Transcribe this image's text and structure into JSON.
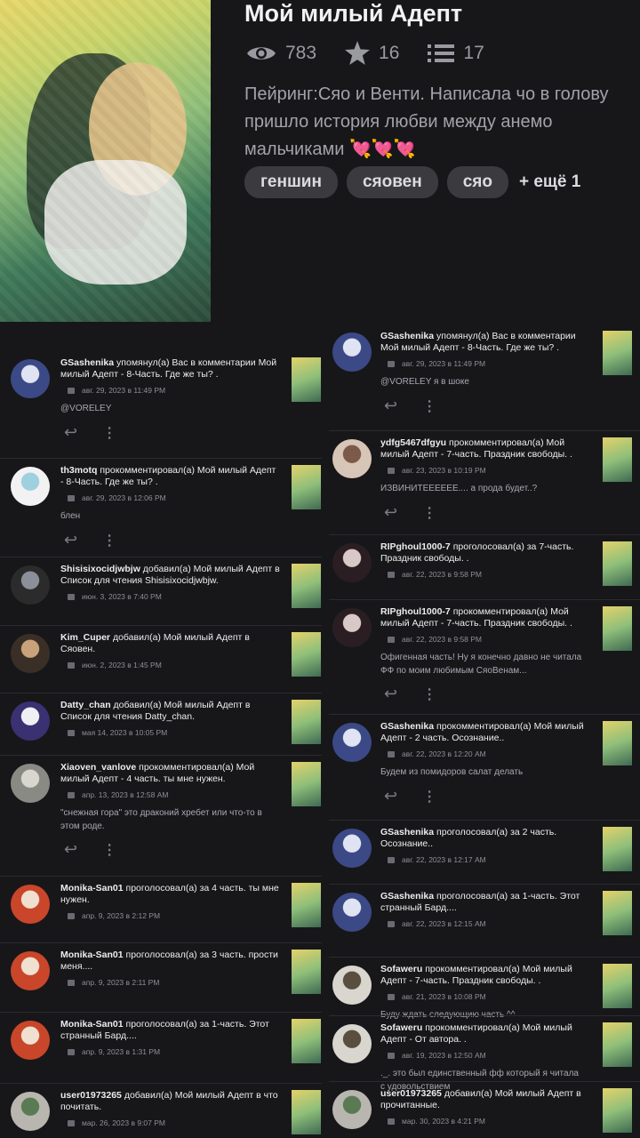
{
  "work": {
    "title": "Мой милый Адепт",
    "views": "783",
    "likes": "16",
    "parts": "17",
    "description": "Пейринг:Сяо и Венти. Написала чо в голову пришло история любви между анемо мальчиками 💘💘💘",
    "tags": [
      "геншин",
      "сяовен",
      "сяо"
    ],
    "more_tags": "+ ещё 1"
  },
  "left": [
    {
      "user": "GSashenika",
      "action": "упомянул(а) Вас в комментарии Мой милый Адепт - 8-Часть. Где же ты? .",
      "time": "авг. 29, 2023 в 11:49 PM",
      "body": "@VORELEY"
    },
    {
      "user": "th3motq",
      "action": "прокомментировал(а) Мой милый Адепт - 8-Часть. Где же ты? .",
      "time": "авг. 29, 2023 в 12:06 PM",
      "body": "блен"
    },
    {
      "user": "Shisisixocidjwbjw",
      "action": "добавил(а) Мой милый Адепт в Список для чтения Shisisixocidjwbjw.",
      "time": "июн. 3, 2023 в 7:40 PM"
    },
    {
      "user": "Kim_Cuper",
      "action": "добавил(а) Мой милый Адепт в Сяовен.",
      "time": "июн. 2, 2023 в 1:45 PM"
    },
    {
      "user": "Datty_chan",
      "action": "добавил(а) Мой милый Адепт в Список для чтения Datty_chan.",
      "time": "мая 14, 2023 в 10:05 PM"
    },
    {
      "user": "Xiaoven_vanlove",
      "action": "прокомментировал(а) Мой милый Адепт - 4 часть. ты мне нужен.",
      "time": "апр. 13, 2023 в 12:58 AM",
      "body": "\"снежная гора\" это драконий хребет или что-то в этом роде."
    },
    {
      "user": "Monika-San01",
      "action": "проголосовал(а) за 4 часть. ты мне нужен.",
      "time": "апр. 9, 2023 в 2:12 PM"
    },
    {
      "user": "Monika-San01",
      "action": "проголосовал(а) за 3 часть. прости меня....",
      "time": "апр. 9, 2023 в 2:11 PM"
    },
    {
      "user": "Monika-San01",
      "action": "проголосовал(а) за 1-часть. Этот странный Бард....",
      "time": "апр. 9, 2023 в 1:31 PM"
    },
    {
      "user": "user01973265",
      "action": "добавил(а) Мой милый Адепт в что почитать.",
      "time": "мар. 26, 2023 в 9:07 PM"
    }
  ],
  "right": [
    {
      "user": "GSashenika",
      "action": "упомянул(а) Вас в комментарии Мой милый Адепт - 8-Часть. Где же ты? .",
      "time": "авг. 29, 2023 в 11:49 PM",
      "body": "@VORELEY я в шоке"
    },
    {
      "user": "ydfg5467dfgyu",
      "action": "прокомментировал(а) Мой милый Адепт - 7-часть. Праздник свободы. .",
      "time": "авг. 23, 2023 в 10:19 PM",
      "body": "ИЗВИНИТЕЕЕЕЕЕ.... а прода будет..?"
    },
    {
      "user": "RIPghoul1000-7",
      "action": "проголосовал(а) за 7-часть. Праздник свободы. .",
      "time": "авг. 22, 2023 в 9:58 PM"
    },
    {
      "user": "RIPghoul1000-7",
      "action": "прокомментировал(а) Мой милый Адепт - 7-часть. Праздник свободы. .",
      "time": "авг. 22, 2023 в 9:58 PM",
      "body": "Офигенная часть! Ну я конечно давно не читала ФФ по моим любимым СяоВенам..."
    },
    {
      "user": "GSashenika",
      "action": "прокомментировал(а) Мой милый Адепт - 2 часть. Осознание..",
      "time": "авг. 22, 2023 в 12:20 AM",
      "body": "Будем из помидоров салат делать"
    },
    {
      "user": "GSashenika",
      "action": "проголосовал(а) за 2 часть. Осознание..",
      "time": "авг. 22, 2023 в 12:17 AM"
    },
    {
      "user": "GSashenika",
      "action": "проголосовал(а) за 1-часть. Этот странный Бард....",
      "time": "авг. 22, 2023 в 12:15 AM"
    },
    {
      "user": "Sofaweru",
      "action": "прокомментировал(а) Мой милый Адепт - 7-часть. Праздник свободы. .",
      "time": "авг. 21, 2023 в 10:08 PM",
      "body": "Буду ждать следующию часть ^^"
    },
    {
      "user": "Sofaweru",
      "action": "прокомментировал(а) Мой милый Адепт - От автора. .",
      "time": "авг. 19, 2023 в 12:50 AM",
      "body": "._. это был единственный фф который я читала с удовольствием"
    },
    {
      "user": "user01973265",
      "action": "добавил(а) Мой милый Адепт в прочитанные.",
      "time": "мар. 30, 2023 в 4:21 PM"
    }
  ],
  "colors": {
    "background": "#17171a",
    "avatar_gsashenika": "#2c3566",
    "avatar_monika": "#c9462a"
  }
}
